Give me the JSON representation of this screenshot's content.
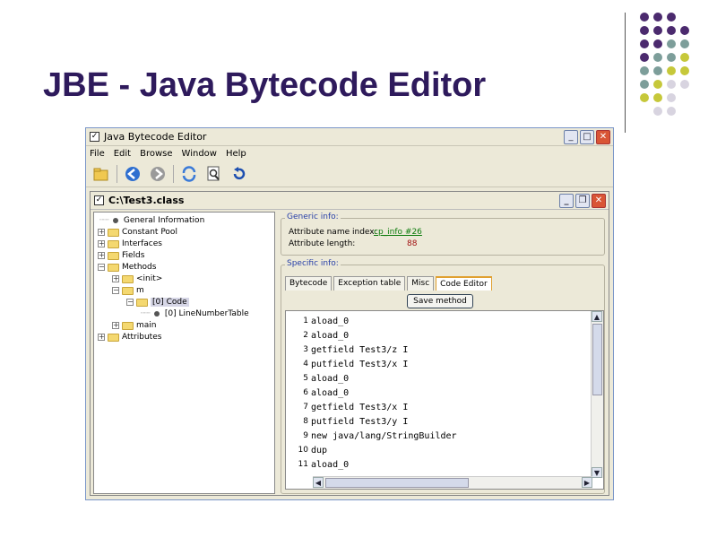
{
  "slide": {
    "title": "JBE - Java Bytecode Editor"
  },
  "decoration": {
    "colors": {
      "purple": "#4b2a6e",
      "teal": "#7d9e9a",
      "lime": "#c6c83a",
      "lavender": "#d8d4e0"
    }
  },
  "window": {
    "title": "Java Bytecode Editor",
    "menu": [
      "File",
      "Edit",
      "Browse",
      "Window",
      "Help"
    ],
    "toolbar_icons": [
      "open-icon",
      "back-icon",
      "forward-icon",
      "refresh-icon",
      "find-icon",
      "reload-icon"
    ]
  },
  "document": {
    "title": "C:\\Test3.class",
    "tree": [
      {
        "label": "General Information",
        "type": "leaf"
      },
      {
        "label": "Constant Pool",
        "type": "folder"
      },
      {
        "label": "Interfaces",
        "type": "folder"
      },
      {
        "label": "Fields",
        "type": "folder"
      },
      {
        "label": "Methods",
        "type": "folder"
      },
      {
        "label": "<init>",
        "type": "folder"
      },
      {
        "label": "m",
        "type": "folder"
      },
      {
        "label": "[0] Code",
        "type": "folder",
        "selected": true
      },
      {
        "label": "[0] LineNumberTable",
        "type": "leaf"
      },
      {
        "label": "main",
        "type": "folder"
      },
      {
        "label": "Attributes",
        "type": "folder"
      }
    ],
    "generic_info": {
      "label": "Generic info:",
      "name_index_label": "Attribute name index:",
      "name_index_value": "cp_info #26",
      "length_label": "Attribute length:",
      "length_value": "88"
    },
    "specific_info": {
      "label": "Specific info:",
      "tabs": [
        "Bytecode",
        "Exception table",
        "Misc",
        "Code Editor"
      ],
      "active_tab": "Code Editor",
      "save_label": "Save method",
      "code_lines": [
        {
          "n": "1",
          "text": "aload_0"
        },
        {
          "n": "2",
          "text": "aload_0"
        },
        {
          "n": "3",
          "text": "getfield Test3/z I"
        },
        {
          "n": "4",
          "text": "putfield Test3/x I"
        },
        {
          "n": "5",
          "text": "aload_0"
        },
        {
          "n": "6",
          "text": "aload_0"
        },
        {
          "n": "7",
          "text": "getfield Test3/x I"
        },
        {
          "n": "8",
          "text": "putfield Test3/y I"
        },
        {
          "n": "9",
          "text": "new java/lang/StringBuilder"
        },
        {
          "n": "10",
          "text": "dup"
        },
        {
          "n": "11",
          "text": "aload_0"
        }
      ]
    }
  }
}
